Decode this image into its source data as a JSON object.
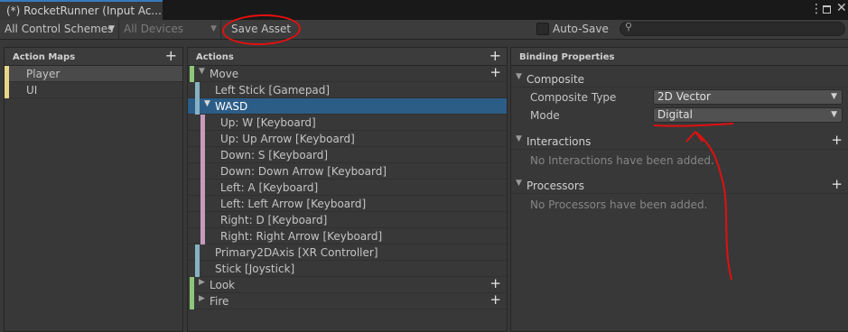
{
  "window": {
    "tab_title": "(*) RocketRunner (Input Ac...",
    "kebab_icon": "kebab-menu-icon",
    "maximize_icon": "maximize-icon",
    "close_icon": "close-icon"
  },
  "toolbar": {
    "control_schemes": "All Control Schemes",
    "devices": "All Devices",
    "save_asset": "Save Asset",
    "auto_save": "Auto-Save",
    "search_placeholder": ""
  },
  "action_maps": {
    "title": "Action Maps",
    "items": [
      {
        "label": "Player",
        "color": "#e8d78a"
      },
      {
        "label": "UI",
        "color": "#e8d78a"
      }
    ]
  },
  "actions": {
    "title": "Actions",
    "rows": [
      {
        "label": "Move",
        "kind": "action",
        "color": "#8fc77a"
      },
      {
        "label": "Left Stick [Gamepad]",
        "kind": "binding",
        "color": "#86b1c2"
      },
      {
        "label": "WASD",
        "kind": "composite",
        "color": "#86b1c2"
      },
      {
        "label": "Up: W [Keyboard]",
        "kind": "part",
        "color": "#c79bbd"
      },
      {
        "label": "Up: Up Arrow [Keyboard]",
        "kind": "part",
        "color": "#c79bbd"
      },
      {
        "label": "Down: S [Keyboard]",
        "kind": "part",
        "color": "#c79bbd"
      },
      {
        "label": "Down: Down Arrow [Keyboard]",
        "kind": "part",
        "color": "#c79bbd"
      },
      {
        "label": "Left: A [Keyboard]",
        "kind": "part",
        "color": "#c79bbd"
      },
      {
        "label": "Left: Left Arrow [Keyboard]",
        "kind": "part",
        "color": "#c79bbd"
      },
      {
        "label": "Right: D [Keyboard]",
        "kind": "part",
        "color": "#c79bbd"
      },
      {
        "label": "Right: Right Arrow [Keyboard]",
        "kind": "part",
        "color": "#c79bbd"
      },
      {
        "label": "Primary2DAxis [XR Controller]",
        "kind": "binding",
        "color": "#86b1c2"
      },
      {
        "label": "Stick [Joystick]",
        "kind": "binding",
        "color": "#86b1c2"
      },
      {
        "label": "Look",
        "kind": "action",
        "color": "#8fc77a"
      },
      {
        "label": "Fire",
        "kind": "action",
        "color": "#8fc77a"
      }
    ]
  },
  "binding": {
    "title": "Binding Properties",
    "composite": {
      "header": "Composite",
      "type_label": "Composite Type",
      "type_value": "2D Vector",
      "mode_label": "Mode",
      "mode_value": "Digital"
    },
    "interactions": {
      "header": "Interactions",
      "empty": "No Interactions have been added."
    },
    "processors": {
      "header": "Processors",
      "empty": "No Processors have been added."
    }
  },
  "colors": {
    "selection": "#2c5d87",
    "annotation": "#e01010"
  }
}
